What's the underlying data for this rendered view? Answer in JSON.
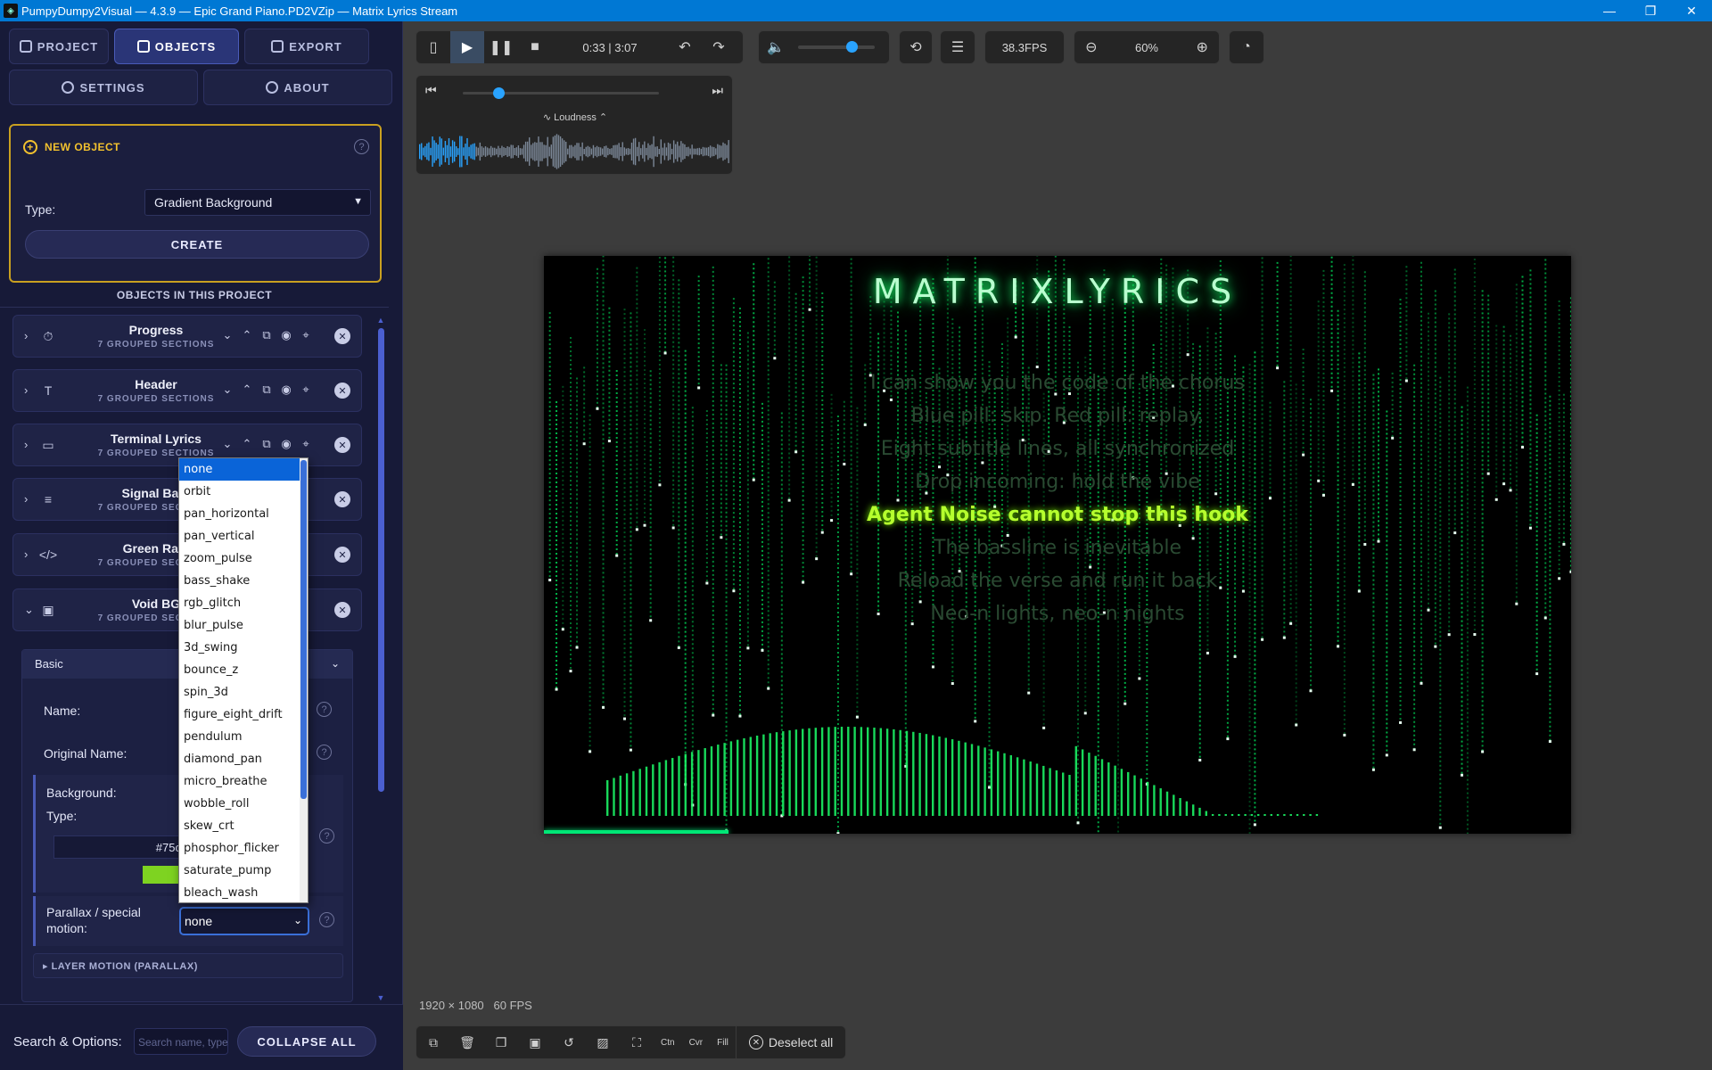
{
  "window": {
    "title": "PumpyDumpy2Visual — 4.3.9 — Epic Grand Piano.PD2VZip — Matrix Lyrics Stream",
    "app_icon": "app-icon",
    "controls": [
      "minimize",
      "restore",
      "close"
    ]
  },
  "tabs": {
    "project": "PROJECT",
    "objects": "OBJECTS",
    "export": "EXPORT",
    "settings": "SETTINGS",
    "about": "ABOUT",
    "active": "objects"
  },
  "new_object": {
    "heading": "NEW OBJECT",
    "type_label": "Type:",
    "type_value": "Gradient Background",
    "create_label": "CREATE"
  },
  "objects_heading": "OBJECTS IN THIS PROJECT",
  "objects": [
    {
      "name": "Progress",
      "sub": "7 GROUPED SECTIONS",
      "icon": "stopwatch-icon"
    },
    {
      "name": "Header",
      "sub": "7 GROUPED SECTIONS",
      "icon": "text-icon"
    },
    {
      "name": "Terminal Lyrics",
      "sub": "7 GROUPED SECTIONS",
      "icon": "message-icon"
    },
    {
      "name": "Signal Bars",
      "sub": "7 GROUPED SECTIONS",
      "icon": "align-icon"
    },
    {
      "name": "Green Rain",
      "sub": "7 GROUPED SECTIONS",
      "icon": "code-icon"
    },
    {
      "name": "Void BG",
      "sub": "7 GROUPED SECTIONS",
      "icon": "image-icon"
    }
  ],
  "expanded_object": {
    "section_label": "Basic",
    "name_label": "Name:",
    "original_name_label": "Original Name:",
    "background_label": "Background:",
    "background_type_label": "Type:",
    "background_color": "#75c",
    "swatch_color": "#7ed321",
    "parallax_label_line1": "Parallax / special",
    "parallax_label_line2": "motion:",
    "parallax_value": "none",
    "layer_motion_label": "LAYER MOTION (PARALLAX)"
  },
  "parallax_options": [
    "none",
    "orbit",
    "pan_horizontal",
    "pan_vertical",
    "zoom_pulse",
    "bass_shake",
    "rgb_glitch",
    "blur_pulse",
    "3d_swing",
    "bounce_z",
    "spin_3d",
    "figure_eight_drift",
    "pendulum",
    "diamond_pan",
    "micro_breathe",
    "wobble_roll",
    "skew_crt",
    "phosphor_flicker",
    "saturate_pump",
    "bleach_wash"
  ],
  "search": {
    "label": "Search & Options:",
    "placeholder": "Search name, type...",
    "collapse_label": "COLLAPSE ALL"
  },
  "toolbar": {
    "time": "0:33 | 3:07",
    "fps": "38.3FPS",
    "zoom": "60%",
    "volume_level": 0.7,
    "accent": "#29a3ff"
  },
  "seek": {
    "position": 0.18,
    "loudness_label": "Loudness"
  },
  "preview": {
    "title": "MATRIXLYRICS",
    "lyrics": [
      "I can show you the code of the chorus",
      "Blue pill: skip. Red pill: replay.",
      "Eight subtitle lines, all synchronized",
      "Drop incoming: hold the vibe",
      "Agent Noise cannot stop this hook",
      "The bassline is inevitable",
      "Reload the verse and run it back",
      "Neo-n lights, neo-n nights"
    ],
    "active_index": 4,
    "progress": 0.18,
    "rain_color": "#00ff66",
    "lyric_color": "#b6ff2e"
  },
  "status": {
    "resolution": "1920 × 1080",
    "fps": "60 FPS"
  },
  "bottom_tools": {
    "center": "Ctn",
    "cover": "Cvr",
    "fill": "Fill",
    "deselect": "Deselect all"
  }
}
